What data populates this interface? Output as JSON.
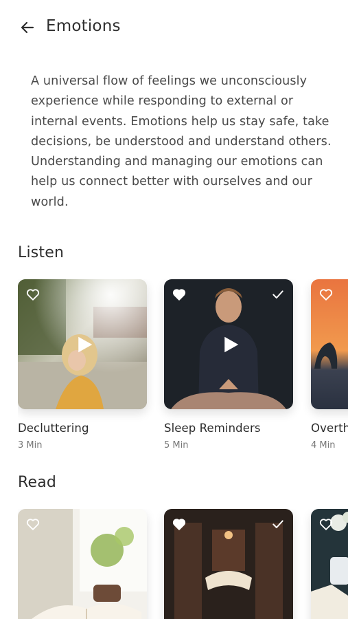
{
  "header": {
    "title": "Emotions",
    "back_icon": "arrow-left-icon"
  },
  "intro": {
    "text": "A universal flow of feelings we unconsciously experience while responding to external or internal events. Emotions help us stay safe, take decisions, be understood and understand others. Understanding and managing our emotions can help us connect better with ourselves and our world."
  },
  "listen": {
    "title": "Listen",
    "items": [
      {
        "title": "Decluttering",
        "duration": "3 Min",
        "favorite": false,
        "completed": false,
        "icon": "play-icon"
      },
      {
        "title": "Sleep Reminders",
        "duration": "5 Min",
        "favorite": true,
        "completed": true,
        "icon": "play-icon"
      },
      {
        "title": "Overth",
        "duration": "4 Min",
        "favorite": false,
        "completed": false,
        "icon": "play-icon"
      }
    ]
  },
  "read": {
    "title": "Read",
    "items": [
      {
        "favorite": false,
        "completed": false
      },
      {
        "favorite": true,
        "completed": true
      },
      {
        "favorite": false,
        "completed": false
      }
    ]
  },
  "colors": {
    "text_primary": "#2f2f2f",
    "text_secondary": "#777777",
    "background": "#ffffff"
  }
}
